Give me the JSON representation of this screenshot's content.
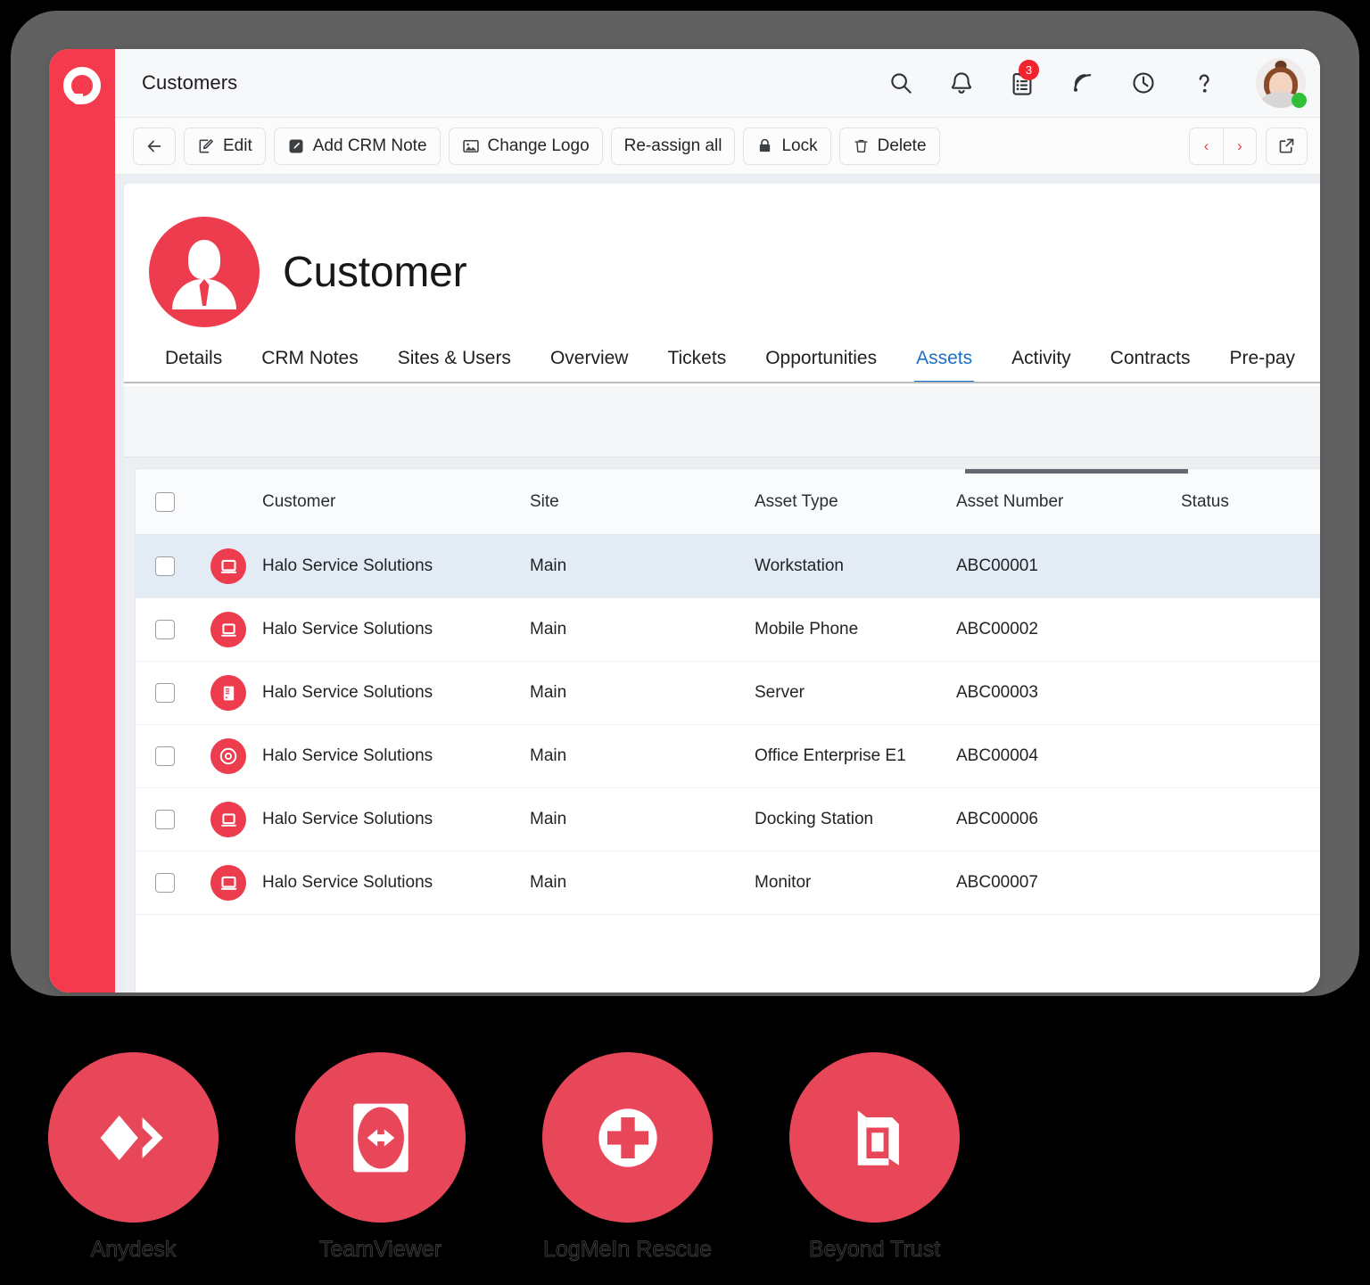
{
  "app": {
    "brand_color": "#F63A4D",
    "accent_blue": "#1D6FC4",
    "logo_icon": "halo-ring-logo"
  },
  "header": {
    "title": "Customers",
    "icons": [
      {
        "name": "search-icon",
        "label": "Search"
      },
      {
        "name": "bell-icon",
        "label": "Notifications"
      },
      {
        "name": "clipboard-icon",
        "label": "Tasks",
        "badge": "3"
      },
      {
        "name": "broadcast-icon",
        "label": "Feed"
      },
      {
        "name": "clock-icon",
        "label": "Recent"
      },
      {
        "name": "help-icon",
        "label": "Help"
      }
    ],
    "avatar": {
      "name": "user-avatar",
      "status": "online",
      "status_color": "#2FBF38"
    }
  },
  "toolbar": {
    "back_label": "",
    "buttons": [
      {
        "name": "back-button",
        "label": "",
        "icon": "arrow-left-icon"
      },
      {
        "name": "edit-button",
        "label": "Edit",
        "icon": "pencil-square-icon"
      },
      {
        "name": "add-crm-note-button",
        "label": "Add CRM Note",
        "icon": "note-pencil-icon"
      },
      {
        "name": "change-logo-button",
        "label": "Change Logo",
        "icon": "image-icon"
      },
      {
        "name": "re-assign-all-button",
        "label": "Re-assign all",
        "icon": ""
      },
      {
        "name": "lock-button",
        "label": "Lock",
        "icon": "lock-icon"
      },
      {
        "name": "delete-button",
        "label": "Delete",
        "icon": "trash-icon"
      }
    ],
    "pager": {
      "prev": "‹",
      "next": "›"
    },
    "popout_label": "",
    "popout_icon": "external-link-icon"
  },
  "record": {
    "title": "Customer",
    "avatar_icon": "person-suit-icon"
  },
  "tabs": [
    {
      "label": "Details",
      "active": false
    },
    {
      "label": "CRM Notes",
      "active": false
    },
    {
      "label": "Sites & Users",
      "active": false
    },
    {
      "label": "Overview",
      "active": false
    },
    {
      "label": "Tickets",
      "active": false
    },
    {
      "label": "Opportunities",
      "active": false
    },
    {
      "label": "Assets",
      "active": true
    },
    {
      "label": "Activity",
      "active": false
    },
    {
      "label": "Contracts",
      "active": false
    },
    {
      "label": "Pre-pay",
      "active": false
    }
  ],
  "table": {
    "columns": [
      "Customer",
      "Site",
      "Asset Type",
      "Asset Number",
      "Status"
    ],
    "rows": [
      {
        "icon": "monitor-icon",
        "customer": "Halo Service Solutions",
        "site": "Main",
        "type": "Workstation",
        "number": "ABC00001",
        "status": "",
        "selected": true
      },
      {
        "icon": "laptop-icon",
        "customer": "Halo Service Solutions",
        "site": "Main",
        "type": "Mobile Phone",
        "number": "ABC00002",
        "status": "",
        "selected": false
      },
      {
        "icon": "server-icon",
        "customer": "Halo Service Solutions",
        "site": "Main",
        "type": "Server",
        "number": "ABC00003",
        "status": "",
        "selected": false
      },
      {
        "icon": "disc-icon",
        "customer": "Halo Service Solutions",
        "site": "Main",
        "type": "Office Enterprise E1",
        "number": "ABC00004",
        "status": "",
        "selected": false
      },
      {
        "icon": "laptop-icon",
        "customer": "Halo Service Solutions",
        "site": "Main",
        "type": "Docking Station",
        "number": "ABC00006",
        "status": "",
        "selected": false
      },
      {
        "icon": "monitor-icon",
        "customer": "Halo Service Solutions",
        "site": "Main",
        "type": "Monitor",
        "number": "ABC00007",
        "status": "",
        "selected": false
      }
    ]
  },
  "integrations": [
    {
      "label": "Anydesk",
      "icon": "anydesk-logo",
      "color": "#E8475A"
    },
    {
      "label": "TeamViewer",
      "icon": "teamviewer-logo",
      "color": "#E8475A"
    },
    {
      "label": "LogMeIn\nRescue",
      "icon": "logmein-logo",
      "color": "#E8475A"
    },
    {
      "label": "Beyond Trust",
      "icon": "beyondtrust-logo",
      "color": "#E8475A"
    }
  ]
}
